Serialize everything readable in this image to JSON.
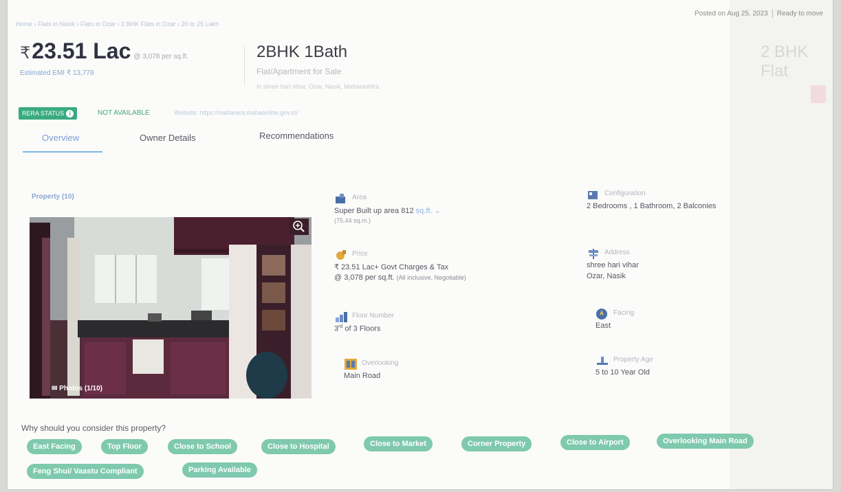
{
  "breadcrumb": "Home › Flats in Nasik › Flats in Ozar › 2 BHK Flats in Ozar › 20 to 25 Lakh",
  "posted": "Posted on Aug 25, 2023",
  "status": "Ready to move",
  "ghost_title": "2 BHK Flat",
  "price": {
    "currency": "₹",
    "amount": "23.51 Lac",
    "per_sqft": "@ 3,078 per sq.ft.",
    "emi": "Estimated EMI ₹ 13,778"
  },
  "title": "2BHK 1Bath",
  "subtitle": "Flat/Apartment for Sale",
  "address_line": "in shree hari vihar, Ozar, Nasik, Maharashtra",
  "rera": {
    "label": "RERA STATUS",
    "value": "NOT AVAILABLE",
    "website": "Website: https://maharera.mahaonline.gov.in/"
  },
  "tabs": [
    {
      "label": "Overview"
    },
    {
      "label": "Owner Details"
    },
    {
      "label": "Recommendations"
    }
  ],
  "property_label": "Property (10)",
  "photos_label": "Photos (1/10)",
  "features": {
    "area": {
      "label": "Area",
      "value": "Super Built up area 812",
      "unit": "sq.ft.",
      "sub": "(75.44 sq.m.)"
    },
    "configuration": {
      "label": "Configuration",
      "value": "2 Bedrooms , 1 Bathroom, 2 Balconies"
    },
    "price": {
      "label": "Price",
      "value": "₹ 23.51 Lac+ Govt Charges & Tax",
      "sub_main": "@ 3,078 per sq.ft.",
      "sub_note": "(All inclusive, Negotiable)"
    },
    "address": {
      "label": "Address",
      "value": "shree hari vihar",
      "sub": "Ozar, Nasik"
    },
    "floor": {
      "label": "Floor Number",
      "floor_no": "3",
      "suffix": "rd",
      "value": "of 3 Floors"
    },
    "facing": {
      "label": "Facing",
      "value": "East"
    },
    "overlooking": {
      "label": "Overlooking",
      "value": "Main Road"
    },
    "age": {
      "label": "Property Age",
      "value": "5 to 10 Year Old"
    }
  },
  "why_heading": "Why should you consider this property?",
  "chips": [
    "East Facing",
    "Top Floor",
    "Close to School",
    "Close to Hospital",
    "Close to Market",
    "Corner Property",
    "Close to Airport",
    "Overlooking Main Road",
    "Feng Shui/ Vaastu Compliant",
    "Parking Available"
  ],
  "colors": {
    "accent": "#39aa82",
    "chip": "#7fc9ae",
    "tab_active": "#7b9fd4",
    "price": "#2f3240"
  }
}
